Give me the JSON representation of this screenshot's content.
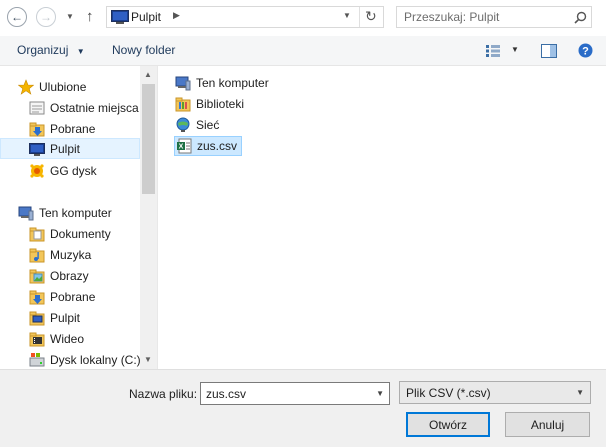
{
  "address": {
    "location": "Pulpit",
    "search_placeholder": "Przeszukaj: Pulpit"
  },
  "toolbar": {
    "organize_label": "Organizuj",
    "new_folder_label": "Nowy folder"
  },
  "nav": {
    "favorites_label": "Ulubione",
    "favorites": [
      {
        "label": "Ostatnie miejsca",
        "icon": "recent-places-icon"
      },
      {
        "label": "Pobrane",
        "icon": "downloads-icon"
      },
      {
        "label": "Pulpit",
        "icon": "desktop-icon",
        "selected": true
      },
      {
        "label": "GG dysk",
        "icon": "gg-disk-icon"
      }
    ],
    "computer_label": "Ten komputer",
    "computer": [
      {
        "label": "Dokumenty",
        "icon": "documents-icon"
      },
      {
        "label": "Muzyka",
        "icon": "music-icon"
      },
      {
        "label": "Obrazy",
        "icon": "pictures-icon"
      },
      {
        "label": "Pobrane",
        "icon": "downloads-icon"
      },
      {
        "label": "Pulpit",
        "icon": "desktop-icon"
      },
      {
        "label": "Wideo",
        "icon": "videos-icon"
      },
      {
        "label": "Dysk lokalny (C:)",
        "icon": "local-disk-icon"
      }
    ]
  },
  "files": [
    {
      "label": "Ten komputer",
      "icon": "computer-icon"
    },
    {
      "label": "Biblioteki",
      "icon": "libraries-icon"
    },
    {
      "label": "Sieć",
      "icon": "network-icon"
    },
    {
      "label": "zus.csv",
      "icon": "csv-file-icon",
      "selected": true
    }
  ],
  "bottom": {
    "filename_label": "Nazwa pliku:",
    "filename_value": "zus.csv",
    "filetype_value": "Plik CSV (*.csv)",
    "open_label": "Otwórz",
    "cancel_label": "Anuluj"
  }
}
